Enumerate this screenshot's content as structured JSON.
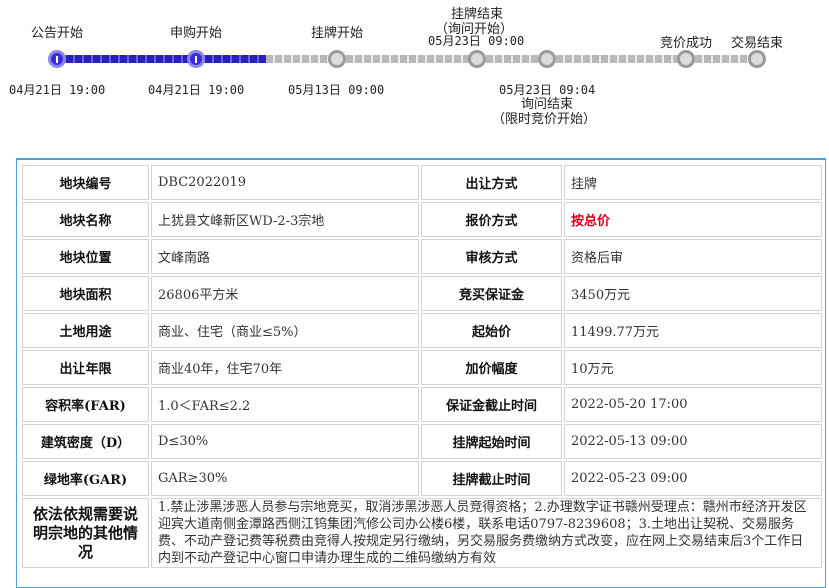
{
  "timeline": {
    "stages": [
      {
        "top_label": "公告开始",
        "date": "04月21日 19:00",
        "done": true
      },
      {
        "top_label": "申购开始",
        "date": "04月21日 19:00",
        "done": true
      },
      {
        "top_label": "挂牌开始",
        "date": "05月13日 09:00",
        "done": false
      },
      {
        "top_label_line1": "挂牌结束",
        "top_label_line2": "（询问开始）",
        "date": "05月23日 09:00",
        "done": false
      },
      {
        "date": "05月23日 09:04",
        "bottom_label_line1": "询问结束",
        "bottom_label_line2": "（限时竞价开始）",
        "done": false
      },
      {
        "top_label": "竞价成功",
        "done": false
      },
      {
        "top_label": "交易结束",
        "done": false
      }
    ]
  },
  "table": {
    "rows": [
      {
        "k1": "地块编号",
        "v1": "DBC2022019",
        "k2": "出让方式",
        "v2": "挂牌"
      },
      {
        "k1": "地块名称",
        "v1": "上犹县文峰新区WD-2-3宗地",
        "k2": "报价方式",
        "v2": "按总价"
      },
      {
        "k1": "地块位置",
        "v1": "文峰南路",
        "k2": "审核方式",
        "v2": "资格后审"
      },
      {
        "k1": "地块面积",
        "v1": "26806平方米",
        "k2": "竞买保证金",
        "v2": "3450万元"
      },
      {
        "k1": "土地用途",
        "v1": "商业、住宅（商业≤5%）",
        "k2": "起始价",
        "v2": "11499.77万元"
      },
      {
        "k1": "出让年限",
        "v1": "商业40年，住宅70年",
        "k2": "加价幅度",
        "v2": "10万元"
      },
      {
        "k1": "容积率(FAR)",
        "v1": "1.0＜FAR≤2.2",
        "k2": "保证金截止时间",
        "v2": "2022-05-20 17:00"
      },
      {
        "k1": "建筑密度（D）",
        "v1": "D≤30%",
        "k2": "挂牌起始时间",
        "v2": "2022-05-13 09:00"
      },
      {
        "k1": "绿地率(GAR)",
        "v1": "GAR≥30%",
        "k2": "挂牌截止时间",
        "v2": "2022-05-23 09:00"
      }
    ],
    "notes_label": "依法依规需要说明宗地的其他情况",
    "notes_text": "1.禁止涉黑涉恶人员参与宗地竞买，取消涉黑涉恶人员竞得资格；2.办理数字证书赣州受理点：赣州市经济开发区迎宾大道南侧金潭路西侧江钨集团汽修公司办公楼6楼，联系电话0797-8239608；3.土地出让契税、交易服务费、不动产登记费等税费由竞得人按规定另行缴纳，另交易服务费缴纳方式改变，应在网上交易结束后3个工作日内到不动产登记中心窗口申请办理生成的二维码缴纳方有效"
  },
  "colors": {
    "timeline_done": "#2a1fbf",
    "timeline_todo": "#b9b9b9",
    "table_border": "#4aa3df",
    "highlight_red": "#d9001b"
  }
}
